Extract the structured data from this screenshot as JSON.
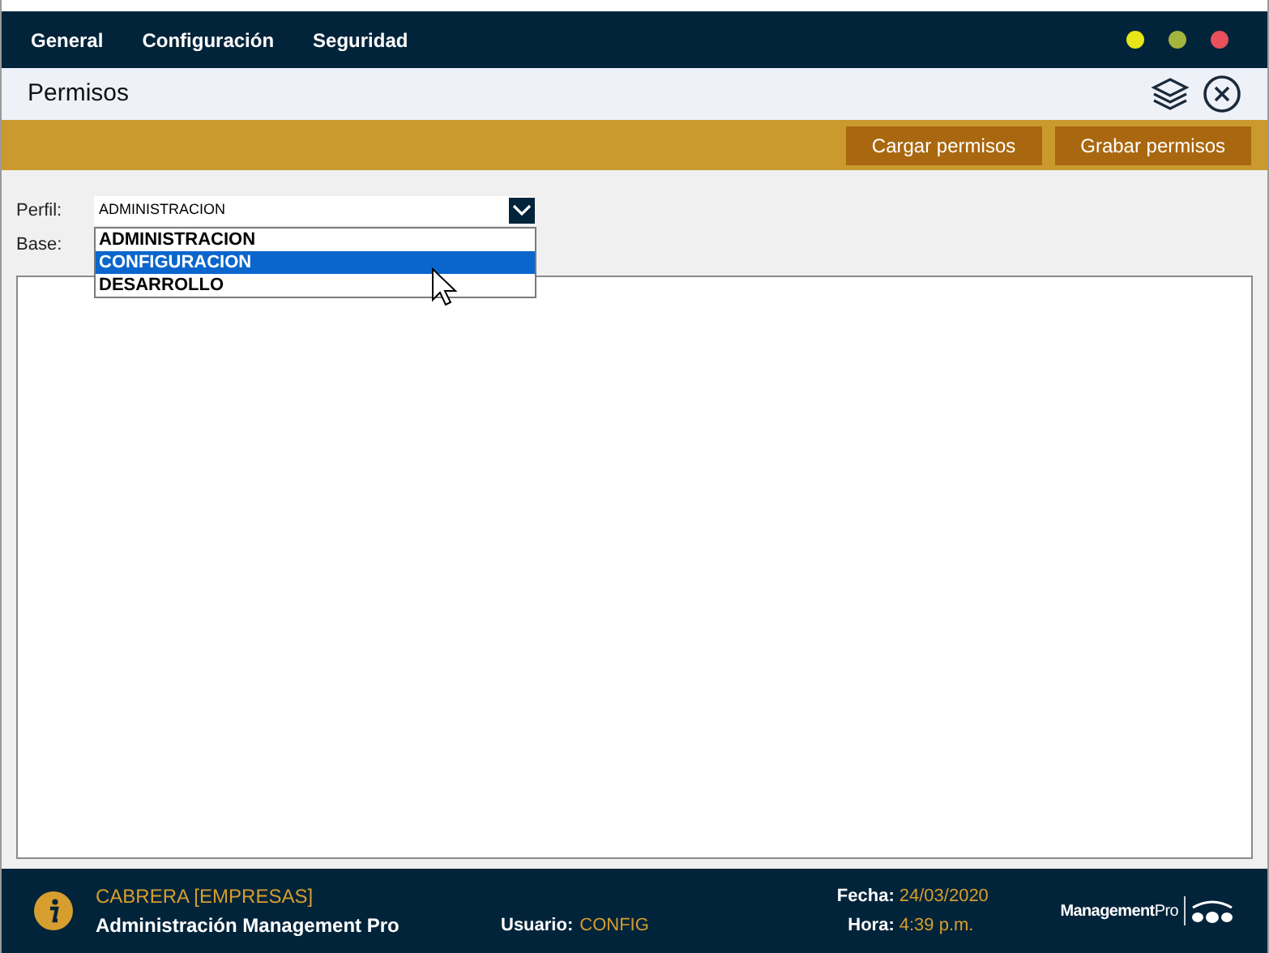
{
  "menu": [
    "General",
    "Configuración",
    "Seguridad"
  ],
  "window_controls": [
    {
      "color": "#e6e619"
    },
    {
      "color": "#a5b43c"
    },
    {
      "color": "#e8505b"
    }
  ],
  "title": "Permisos",
  "toolbar_buttons": [
    "Cargar permisos",
    "Grabar permisos"
  ],
  "form": {
    "perfil_label": "Perfil:",
    "perfil_value": "ADMINISTRACION",
    "base_label": "Base:",
    "expanded": true,
    "options": [
      {
        "label": "ADMINISTRACION",
        "selected": false
      },
      {
        "label": "CONFIGURACION",
        "selected": true
      },
      {
        "label": "DESARROLLO",
        "selected": false
      }
    ]
  },
  "status_bar": {
    "company": "CABRERA [EMPRESAS]",
    "app": "Administración Management Pro",
    "user_label": "Usuario:",
    "user": "CONFIG",
    "date_label": "Fecha:",
    "date": "24/03/2020",
    "time_label": "Hora:",
    "time": "4:39 p.m.",
    "logo": "**Management**Pro"
  }
}
